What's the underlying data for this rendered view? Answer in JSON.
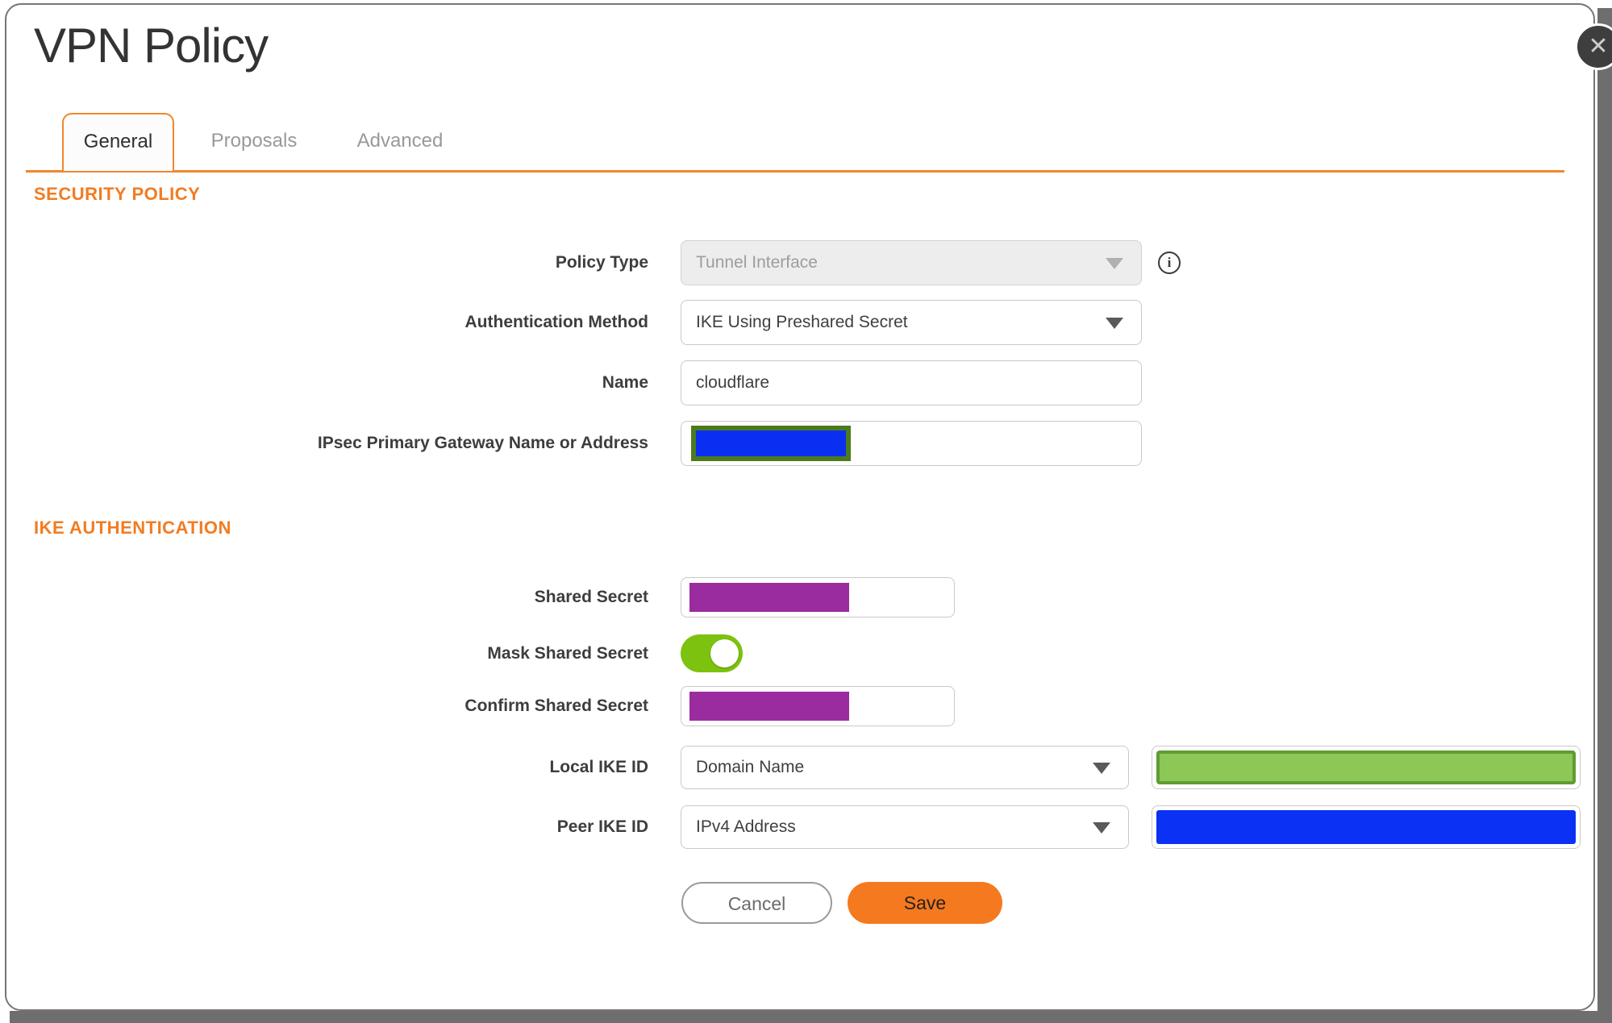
{
  "dialog": {
    "title": "VPN Policy"
  },
  "icons": {
    "close": "✕",
    "info": "i"
  },
  "tabs": [
    {
      "label": "General",
      "active": true
    },
    {
      "label": "Proposals",
      "active": false
    },
    {
      "label": "Advanced",
      "active": false
    }
  ],
  "sections": {
    "security_policy": "SECURITY POLICY",
    "ike_authentication": "IKE AUTHENTICATION"
  },
  "fields": {
    "policy_type": {
      "label": "Policy Type",
      "value": "Tunnel Interface",
      "disabled": true
    },
    "authentication_method": {
      "label": "Authentication Method",
      "value": "IKE Using Preshared Secret"
    },
    "name": {
      "label": "Name",
      "value": "cloudflare"
    },
    "gateway": {
      "label": "IPsec Primary Gateway Name or Address",
      "value": "",
      "redacted": "blue-box-green-border"
    },
    "shared_secret": {
      "label": "Shared Secret",
      "value": "",
      "redacted": "purple-box"
    },
    "mask_shared_secret": {
      "label": "Mask Shared Secret",
      "toggle_on": true
    },
    "confirm_shared_secret": {
      "label": "Confirm Shared Secret",
      "value": "",
      "redacted": "purple-box"
    },
    "local_ike_id": {
      "label": "Local IKE ID",
      "value": "Domain Name",
      "side_value_redacted": "green-box"
    },
    "peer_ike_id": {
      "label": "Peer IKE ID",
      "value": "IPv4 Address",
      "side_value_redacted": "blue-box"
    }
  },
  "buttons": {
    "cancel": "Cancel",
    "save": "Save"
  },
  "colors": {
    "accent_orange": "#f17c22",
    "save_orange": "#f5791f",
    "toggle_green": "#7cc20e",
    "redaction_purple": "#9b2c9f",
    "redaction_blue": "#0b2ff1",
    "redaction_green_fill": "#8dc756",
    "redaction_green_border": "#5e9d32",
    "redaction_olive_border": "#4c7a1d",
    "outside_background": "#6e6e6e"
  }
}
